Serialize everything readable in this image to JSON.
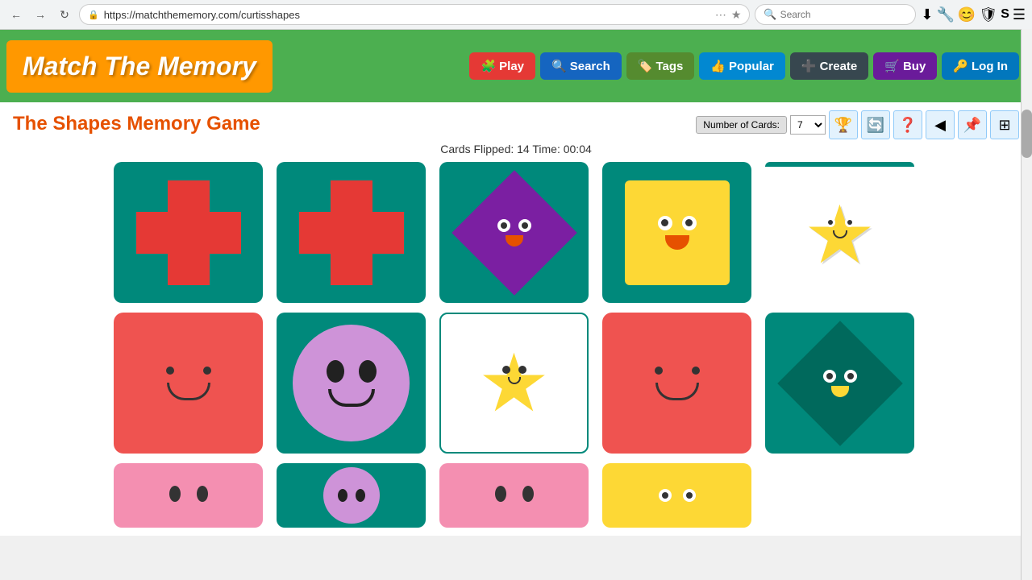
{
  "browser": {
    "url": "https://matchthememory.com/curtisshapes",
    "search_placeholder": "Search",
    "nav": {
      "back": "←",
      "forward": "→",
      "refresh": "↻"
    }
  },
  "header": {
    "logo": "Match The Memory",
    "nav_buttons": [
      {
        "id": "play",
        "label": "Play",
        "icon": "🧩"
      },
      {
        "id": "search",
        "label": "Search",
        "icon": "🔍"
      },
      {
        "id": "tags",
        "label": "Tags",
        "icon": "🏷️"
      },
      {
        "id": "popular",
        "label": "Popular",
        "icon": "👍"
      },
      {
        "id": "create",
        "label": "Create",
        "icon": "➕"
      },
      {
        "id": "buy",
        "label": "Buy",
        "icon": "🛒"
      },
      {
        "id": "login",
        "label": "Log In",
        "icon": "🔑"
      }
    ]
  },
  "game": {
    "title": "The Shapes Memory Game",
    "stats": "Cards Flipped: 14  Time: 00:04",
    "cards_label": "Number of Cards:",
    "cards_value": "7",
    "controls": [
      "🏆",
      "🔄",
      "❓",
      "◀",
      "📌",
      "⊞"
    ]
  }
}
